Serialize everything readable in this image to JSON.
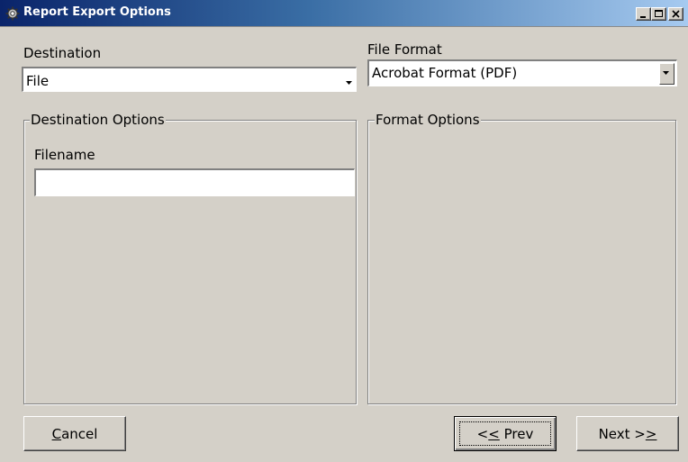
{
  "window": {
    "title": "Report Export Options",
    "icon": "gear-icon",
    "controls": [
      "minimize-icon",
      "maximize-icon",
      "close-icon"
    ]
  },
  "destination": {
    "label": "Destination",
    "value": "File"
  },
  "file_format": {
    "label": "File Format",
    "value": "Acrobat Format (PDF)"
  },
  "destination_options": {
    "legend": "Destination Options",
    "filename_label": "Filename",
    "filename_value": ""
  },
  "format_options": {
    "legend": "Format Options"
  },
  "buttons": {
    "cancel": {
      "prefix": "",
      "accel": "C",
      "suffix": "ancel"
    },
    "prev": {
      "prefix": "<",
      "accel": "<",
      "suffix": " Prev"
    },
    "next": {
      "prefix": "Next ",
      "accel": ">",
      "suffix": ">"
    }
  },
  "colors": {
    "face": "#d4d0c8",
    "title_start": "#0a246a",
    "title_end": "#a6caf0"
  }
}
